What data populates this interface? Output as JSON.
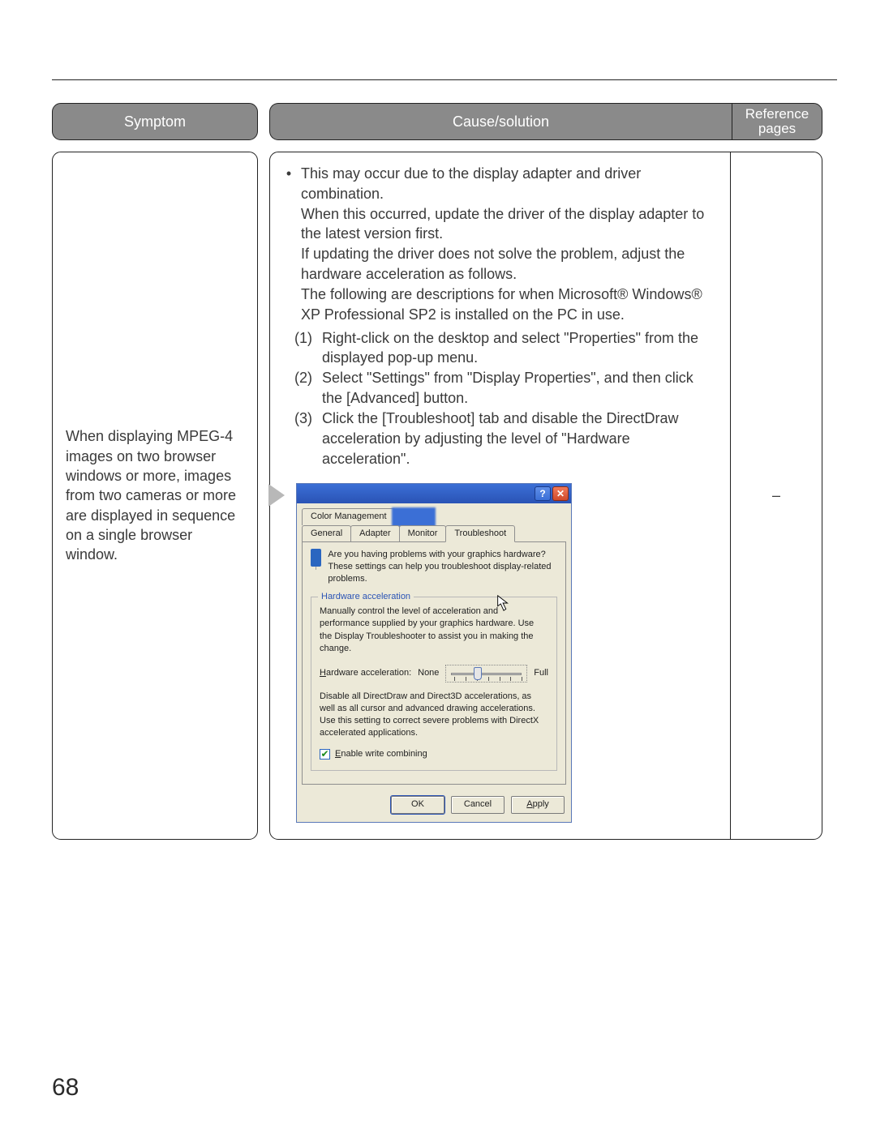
{
  "headers": {
    "symptom": "Symptom",
    "cause": "Cause/solution",
    "ref": "Reference pages"
  },
  "row": {
    "symptom": "When displaying MPEG-4 images on two browser win­dows or more, images from two cameras or more are displayed in sequence on a single browser window.",
    "ref": "–",
    "cause": {
      "lead": "This may occur due to the display adapter and driver combination.\nWhen this occurred, update the driver of the display adapter to the latest version first.\nIf updating the driver does not solve the problem, adjust the hardware acceleration as follows.\nThe following are descriptions for when Microsoft® Windows® XP Professional SP2 is installed on the PC in use.",
      "steps": [
        {
          "n": "(1)",
          "t": "Right-click on the desktop and select \"Properties\" from the displayed pop-up menu."
        },
        {
          "n": "(2)",
          "t": "Select \"Settings\" from \"Display Properties\", and then click the [Advanced] button."
        },
        {
          "n": "(3)",
          "t": "Click the [Troubleshoot] tab and disable the DirectDraw acceleration by adjusting the level of \"Hardware acceleration\"."
        }
      ]
    }
  },
  "dialog": {
    "help_btn": "?",
    "close_btn": "✕",
    "tabs_row1": [
      "Color Management"
    ],
    "tabs_row2": [
      "General",
      "Adapter",
      "Monitor",
      "Troubleshoot"
    ],
    "intro": "Are you having problems with your graphics hardware? These settings can help you troubleshoot display-related problems.",
    "group_title": "Hardware acceleration",
    "group_desc": "Manually control the level of acceleration and performance supplied by your graphics hardware. Use the Display Troubleshooter to assist you in making the change.",
    "slider_label_pre": "H",
    "slider_label_rest": "ardware acceleration:",
    "slider_none": "None",
    "slider_full": "Full",
    "slider_note": "Disable all DirectDraw and Direct3D accelerations, as well as all cursor and advanced drawing accelerations. Use this setting to correct severe problems with DirectX accelerated applications.",
    "checkbox_pre": "E",
    "checkbox_rest": "nable write combining",
    "ok": "OK",
    "cancel": "Cancel",
    "apply_pre": "A",
    "apply_rest": "pply"
  },
  "page_number": "68"
}
